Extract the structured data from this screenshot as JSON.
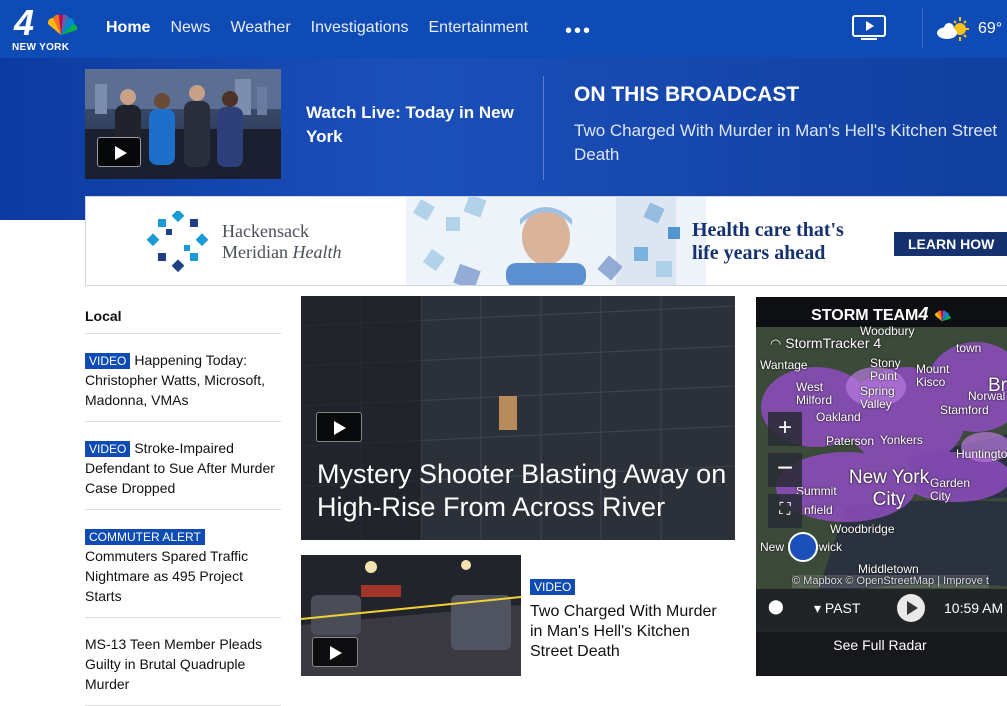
{
  "brand": {
    "channel": "4",
    "city": "NEW YORK"
  },
  "nav": {
    "items": [
      {
        "label": "Home"
      },
      {
        "label": "News"
      },
      {
        "label": "Weather"
      },
      {
        "label": "Investigations"
      },
      {
        "label": "Entertainment"
      }
    ],
    "more": "•••",
    "temperature": "69°"
  },
  "hero": {
    "watch_live": "Watch Live: Today in New York",
    "broadcast_heading": "ON THIS BROADCAST",
    "broadcast_story": "Two Charged With Murder in Man's Hell's Kitchen Street Death"
  },
  "ad": {
    "brand_line1": "Hackensack",
    "brand_line2a": "Meridian ",
    "brand_line2b": "Health",
    "tagline1": "Health care that's",
    "tagline2": "life years ahead",
    "cta": "LEARN HOW"
  },
  "local": {
    "heading": "Local",
    "items": [
      {
        "badge": "VIDEO",
        "title": "Happening Today: Christopher Watts, Microsoft, Madonna, VMAs"
      },
      {
        "badge": "VIDEO",
        "title": "Stroke-Impaired Defendant to Sue After Murder Case Dropped"
      },
      {
        "badge": "COMMUTER ALERT",
        "title": "Commuters Spared Traffic Nightmare as 495 Project Starts"
      },
      {
        "badge": "",
        "title": "MS-13 Teen Member Pleads Guilty in Brutal Quadruple Murder"
      }
    ]
  },
  "main_story": {
    "title": "Mystery Shooter Blasting Away on High-Rise From Across River"
  },
  "second_story": {
    "badge": "VIDEO",
    "title": "Two Charged With Murder in Man's Hell's Kitchen Street Death"
  },
  "radar": {
    "heading": "STORM TEAM",
    "heading_num": "4",
    "tracker": "StormTracker 4",
    "attribution": "© Mapbox © OpenStreetMap | Improve t",
    "past": "PAST",
    "time": "10:59 AM",
    "full_radar": "See Full Radar",
    "places": {
      "wantage": "Wantage",
      "woodbury": "Woodbury",
      "stony_point": "Stony Point",
      "mount_kisco": "Mount Kisco",
      "bri": "Bri",
      "west_milford": "West Milford",
      "spring_valley": "Spring Valley",
      "norwalk": "Norwal",
      "oakland": "Oakland",
      "stamford": "Stamford",
      "paterson": "Paterson",
      "yonkers": "Yonkers",
      "huntington": "Huntingto",
      "new_york": "New York City",
      "garden_city": "Garden City",
      "summit": "Summit",
      "plainfield": "nfield",
      "woodbridge": "Woodbridge",
      "new_brunswick": "New Brunswick",
      "middletown": "Middletown",
      "kingstown": "town"
    }
  }
}
